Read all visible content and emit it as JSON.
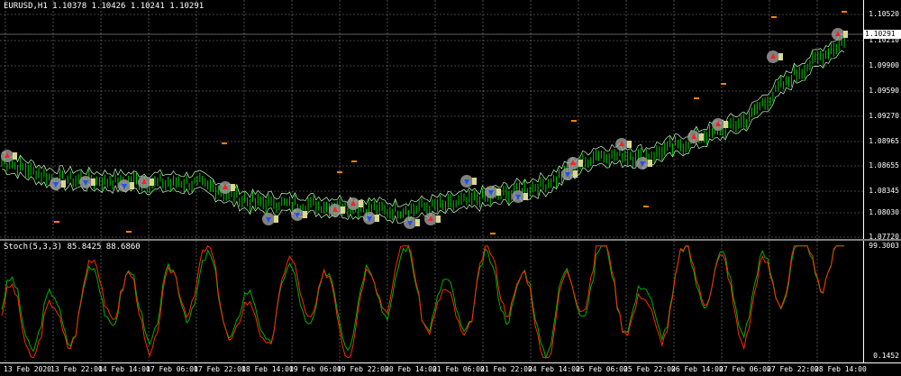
{
  "main_header": "EURUSD,H1  1.10378 1.10426 1.10241 1.10291",
  "stoch_header": "Stoch(5,3,3) 85.8425 88.6860",
  "current_price": "1.10291",
  "price_ticks": [
    "1.10520",
    "1.10210",
    "1.09900",
    "1.09590",
    "1.09270",
    "1.08965",
    "1.08655",
    "1.08345",
    "1.08030",
    "1.07720"
  ],
  "stoch_ticks": [
    "99.3003",
    "0.1452"
  ],
  "time_ticks": [
    "13 Feb 2020",
    "13 Feb 22:00",
    "14 Feb 14:00",
    "17 Feb 06:00",
    "17 Feb 22:00",
    "18 Feb 14:00",
    "19 Feb 06:00",
    "19 Feb 22:00",
    "20 Feb 14:00",
    "21 Feb 06:00",
    "21 Feb 22:00",
    "24 Feb 14:00",
    "25 Feb 06:00",
    "25 Feb 22:00",
    "26 Feb 14:00",
    "27 Feb 06:00",
    "27 Feb 22:00",
    "28 Feb 14:00"
  ],
  "colors": {
    "background": "#000000",
    "candles": "#00c800",
    "grid": "#808080",
    "stoch_main": "#ff2a00",
    "stoch_signal": "#00b000",
    "buy_arrow": "#2050ff",
    "sell_arrow": "#ff2020",
    "marker_halo": "#a0a0a0",
    "marker_tag": "#d8d890"
  },
  "chart_data": [
    {
      "type": "line",
      "title": "EURUSD,H1",
      "ylim": [
        1.0772,
        1.1064
      ],
      "x": [
        "13 Feb 2020",
        "13 Feb 22:00",
        "14 Feb 14:00",
        "17 Feb 06:00",
        "17 Feb 22:00",
        "18 Feb 14:00",
        "19 Feb 06:00",
        "19 Feb 22:00",
        "20 Feb 14:00",
        "21 Feb 06:00",
        "21 Feb 22:00",
        "24 Feb 14:00",
        "25 Feb 06:00",
        "25 Feb 22:00",
        "26 Feb 14:00",
        "27 Feb 06:00",
        "27 Feb 22:00",
        "28 Feb 14:00"
      ],
      "series": [
        {
          "values": [
            1.0872,
            1.085,
            1.0846,
            1.0844,
            1.0843,
            1.0818,
            1.0815,
            1.0812,
            1.0806,
            1.0815,
            1.0826,
            1.0842,
            1.088,
            1.0878,
            1.09,
            1.0925,
            1.0985,
            1.1029
          ]
        }
      ]
    },
    {
      "type": "line",
      "title": "Stoch(5,3,3) 85.8425 88.6860",
      "ylim": [
        0.1452,
        99.3003
      ],
      "x": [
        "13 Feb 2020",
        "13 Feb 22:00",
        "14 Feb 14:00",
        "17 Feb 06:00",
        "17 Feb 22:00",
        "18 Feb 14:00",
        "19 Feb 06:00",
        "19 Feb 22:00",
        "20 Feb 14:00",
        "21 Feb 06:00",
        "21 Feb 22:00",
        "24 Feb 14:00",
        "25 Feb 06:00",
        "25 Feb 22:00",
        "26 Feb 14:00",
        "27 Feb 06:00",
        "27 Feb 22:00",
        "28 Feb 14:00"
      ],
      "series": [
        {
          "values": [
            40,
            20,
            70,
            30,
            80,
            20,
            70,
            30,
            85,
            30,
            80,
            20,
            90,
            25,
            85,
            40,
            90,
            86
          ]
        },
        {
          "values": [
            45,
            30,
            60,
            40,
            70,
            30,
            60,
            40,
            75,
            40,
            70,
            30,
            80,
            35,
            80,
            50,
            85,
            89
          ]
        }
      ]
    }
  ]
}
